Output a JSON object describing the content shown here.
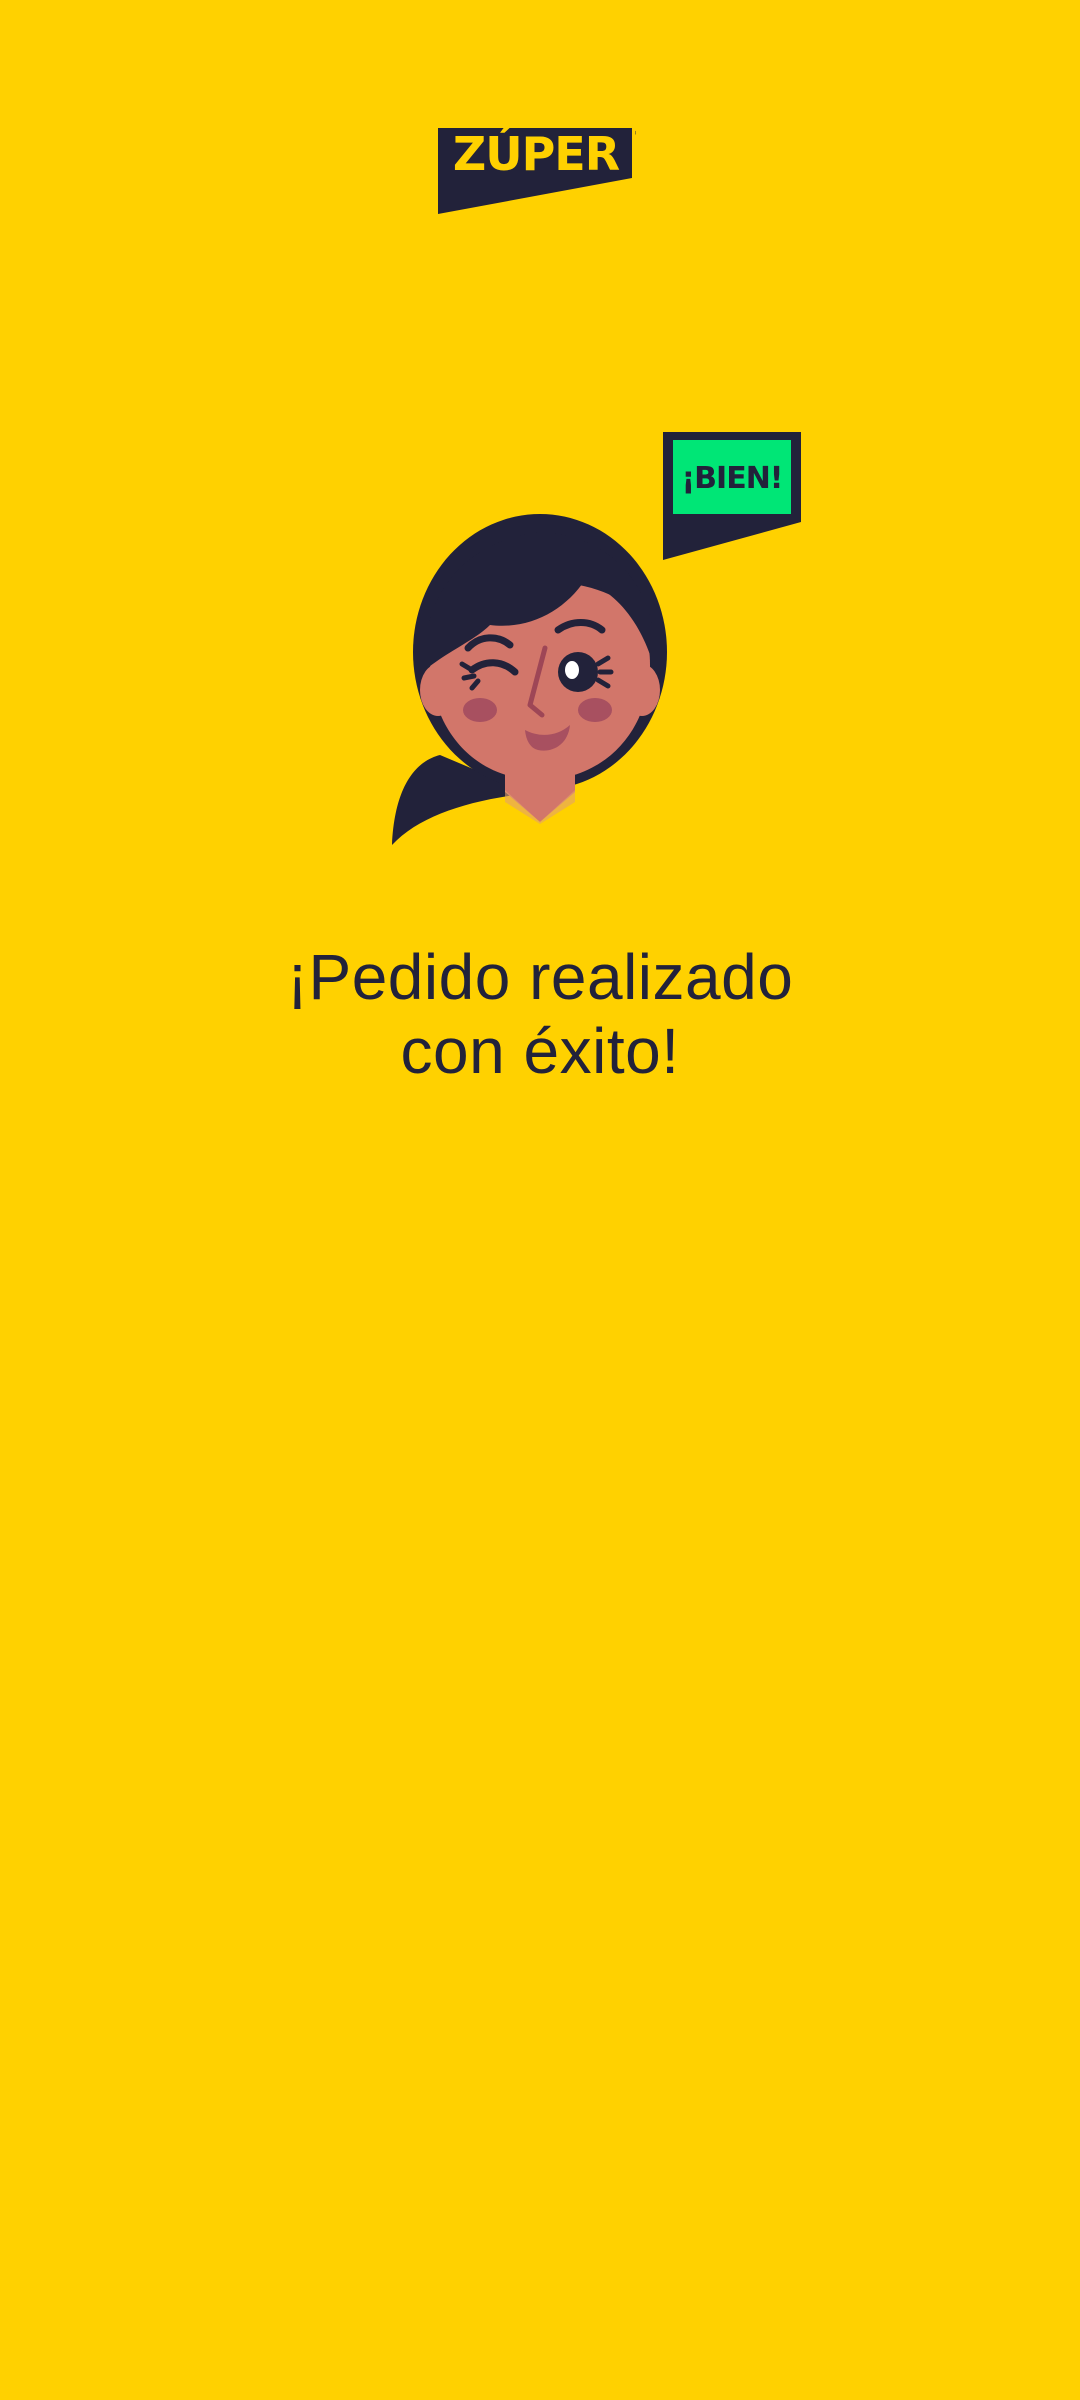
{
  "brand": {
    "logo_text": "ZÚPER",
    "trademark": "®"
  },
  "badge": {
    "text": "¡BIEN!"
  },
  "message": {
    "line1": "¡Pedido realizado",
    "line2": "con éxito!"
  },
  "colors": {
    "background": "#FFD100",
    "navy": "#22223A",
    "badge_green": "#00E676",
    "skin": "#D2766A",
    "cheek": "#A85060"
  },
  "icons": {
    "logo": "zuper-logo",
    "character": "winking-woman-illustration",
    "badge": "speech-bubble-bien"
  }
}
